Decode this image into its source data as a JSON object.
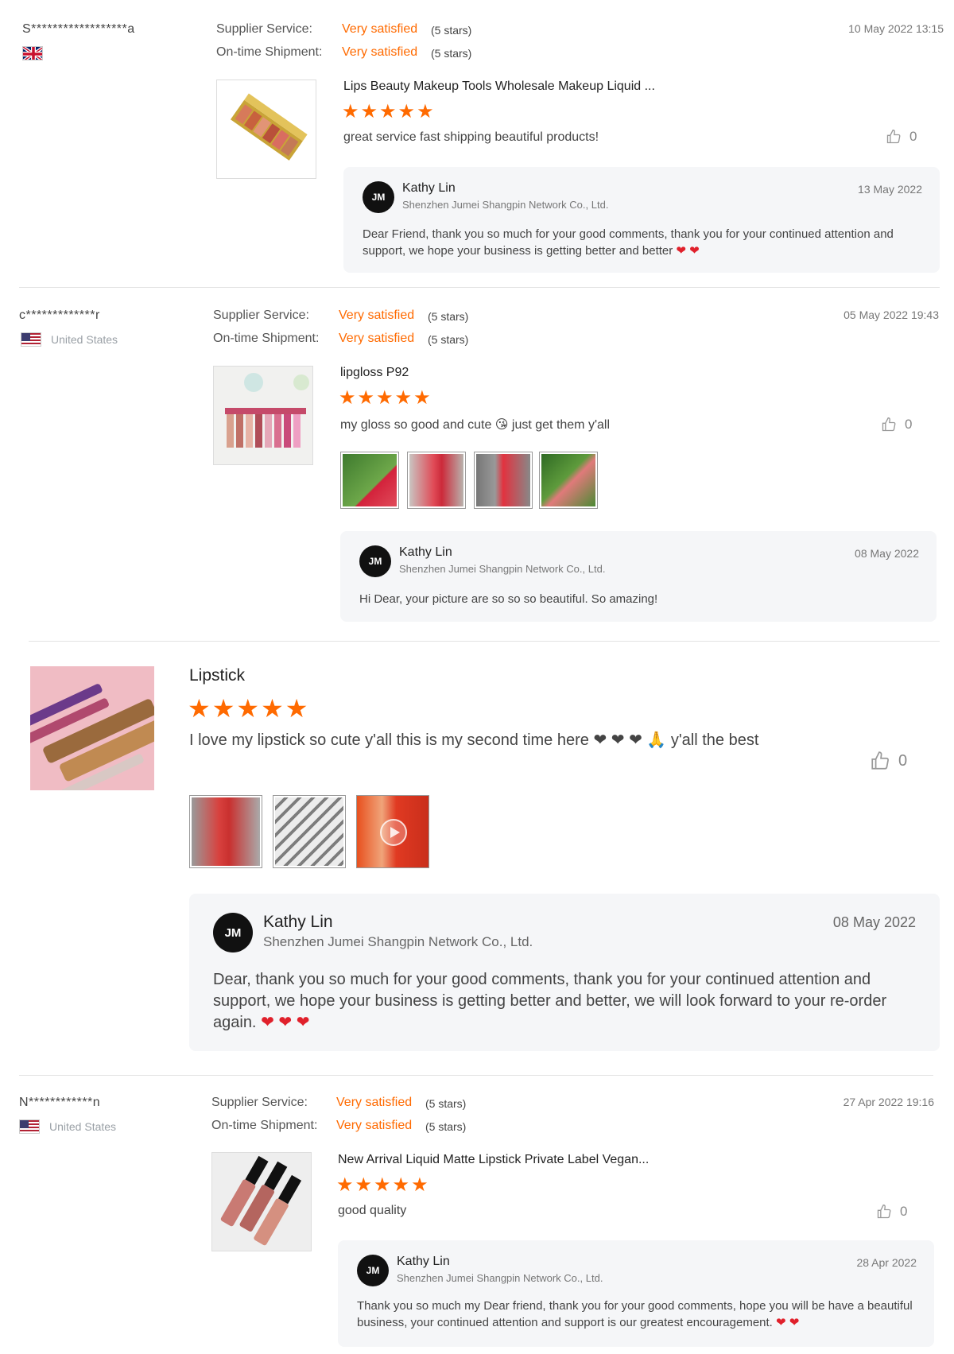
{
  "colors": {
    "accent": "#ff6a00",
    "heart": "#e0202b",
    "reply_bg": "#f5f6f8"
  },
  "reviews": [
    {
      "reviewer": "S******************a",
      "flag": "uk-flag-icon",
      "country": "",
      "supplier_label": "Supplier Service:",
      "supplier_value": "Very satisfied",
      "supplier_stars": "(5 stars)",
      "shipment_label": "On-time Shipment:",
      "shipment_value": "Very satisfied",
      "shipment_stars": "(5 stars)",
      "date": "10 May 2022 13:15",
      "product_title": "Lips Beauty Makeup Tools Wholesale Makeup Liquid ...",
      "rating": 5,
      "stars": "★★★★★",
      "comment": "great service fast shipping beautiful products!",
      "likes": "0",
      "reply": {
        "avatar": "JM",
        "name": "Kathy Lin",
        "company": "Shenzhen Jumei Shangpin Network Co., Ltd.",
        "date": "13 May 2022",
        "text": "Dear Friend, thank you so much for your good comments, thank you for your continued attention and support, we hope your business is getting better and better",
        "hearts": "❤ ❤"
      }
    },
    {
      "reviewer": "c*************r",
      "flag": "us-flag-icon",
      "country": "United States",
      "supplier_label": "Supplier Service:",
      "supplier_value": "Very satisfied",
      "supplier_stars": "(5 stars)",
      "shipment_label": "On-time Shipment:",
      "shipment_value": "Very satisfied",
      "shipment_stars": "(5 stars)",
      "date": "05 May 2022 19:43",
      "product_title": "lipgloss P92",
      "rating": 5,
      "stars": "★★★★★",
      "comment": "my gloss so good and cute 😘 just get them y'all",
      "likes": "0",
      "reply": {
        "avatar": "JM",
        "name": "Kathy Lin",
        "company": "Shenzhen Jumei Shangpin Network Co., Ltd.",
        "date": "08 May 2022",
        "text": "Hi Dear, your picture are so so so beautiful. So amazing!",
        "hearts": ""
      }
    },
    {
      "reviewer": "",
      "country": "",
      "date": "",
      "product_title": "Lipstick",
      "rating": 5,
      "stars": "★★★★★",
      "comment": "I love my lipstick so cute y'all this is my second time here ❤ ❤ ❤ 🙏 y'all the best",
      "likes": "0",
      "reply": {
        "avatar": "JM",
        "name": "Kathy Lin",
        "company": "Shenzhen Jumei Shangpin Network Co., Ltd.",
        "date": "08 May 2022",
        "text": "Dear, thank you so much for your good comments, thank you for your continued attention and support, we hope your business is getting better and better, we will look forward to your re-order again.",
        "hearts": "❤ ❤ ❤"
      }
    },
    {
      "reviewer": "N************n",
      "flag": "us-flag-icon",
      "country": "United States",
      "supplier_label": "Supplier Service:",
      "supplier_value": "Very satisfied",
      "supplier_stars": "(5 stars)",
      "shipment_label": "On-time Shipment:",
      "shipment_value": "Very satisfied",
      "shipment_stars": "(5 stars)",
      "date": "27 Apr 2022 19:16",
      "product_title": "New Arrival Liquid Matte Lipstick Private Label Vegan...",
      "rating": 5,
      "stars": "★★★★★",
      "comment": "good quality",
      "likes": "0",
      "reply": {
        "avatar": "JM",
        "name": "Kathy Lin",
        "company": "Shenzhen Jumei Shangpin Network Co., Ltd.",
        "date": "28 Apr 2022",
        "text": "Thank you so much my Dear friend, thank you for your good comments, hope you will be have a beautiful business, your continued attention and support is our greatest encouragement.",
        "hearts": "❤ ❤"
      }
    }
  ]
}
